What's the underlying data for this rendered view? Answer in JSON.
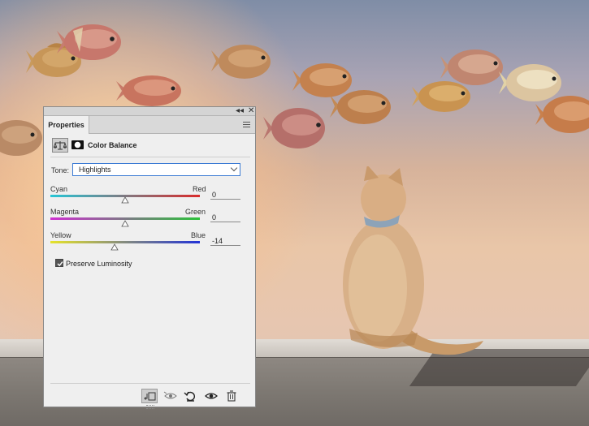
{
  "panel": {
    "tab_label": "Properties",
    "header_title": "Color Balance",
    "tone": {
      "label": "Tone:",
      "value": "Highlights"
    },
    "sliders": [
      {
        "left": "Cyan",
        "right": "Red",
        "value": "0",
        "level": 0
      },
      {
        "left": "Magenta",
        "right": "Green",
        "value": "0",
        "level": 0
      },
      {
        "left": "Yellow",
        "right": "Blue",
        "value": "-14",
        "level": -14
      }
    ],
    "preserve_luminosity": {
      "label": "Preserve Luminosity",
      "checked": true
    },
    "top_controls": {
      "collapse": "◂◂",
      "close": "✕"
    },
    "colors": {
      "cyan_red": [
        "#26c6d6",
        "#d92b2b"
      ],
      "magenta_green": [
        "#cf2fd2",
        "#2cc23a"
      ],
      "yellow_blue": [
        "#e6e32a",
        "#2233d6"
      ],
      "select_border": "#3b7bd4"
    }
  },
  "bottom_icons": [
    "clip-to-layer-icon",
    "view-previous-icon",
    "reset-icon",
    "visibility-icon",
    "trash-icon"
  ]
}
